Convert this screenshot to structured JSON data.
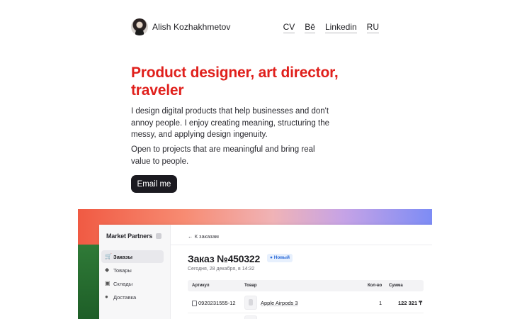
{
  "header": {
    "name": "Alish Kozhakhmetov",
    "nav": [
      "CV",
      "Bē",
      "Linkedin",
      "RU"
    ]
  },
  "hero": {
    "title": "Product designer, art director, traveler",
    "paragraph1": "I design digital products that help businesses and don't annoy people. I enjoy creating meaning, structuring the messy, and applying design ingenuity.",
    "paragraph2": "Open to projects that are meaningful and bring real value to people.",
    "cta": "Email me",
    "title_color": "#e0201c"
  },
  "showcase": {
    "brand": "Market Partners",
    "sidebar": [
      {
        "label": "Заказы",
        "icon": "cart-icon",
        "active": true
      },
      {
        "label": "Товары",
        "icon": "tag-icon",
        "active": false
      },
      {
        "label": "Склады",
        "icon": "box-icon",
        "active": false
      },
      {
        "label": "Доставка",
        "icon": "delivery-icon",
        "active": false
      }
    ],
    "back_link": "← К заказам",
    "order_title": "Заказ №450322",
    "status": "Новый",
    "order_date": "Сегодня, 28 декабря, в 14:32",
    "table": {
      "headers": [
        "Артикул",
        "Товар",
        "Кол-во",
        "Сумма"
      ],
      "rows": [
        {
          "sku": "0920231555-12",
          "product": "Apple Airpods 3",
          "qty": "1",
          "sum": "122 321 ₸"
        }
      ]
    }
  }
}
